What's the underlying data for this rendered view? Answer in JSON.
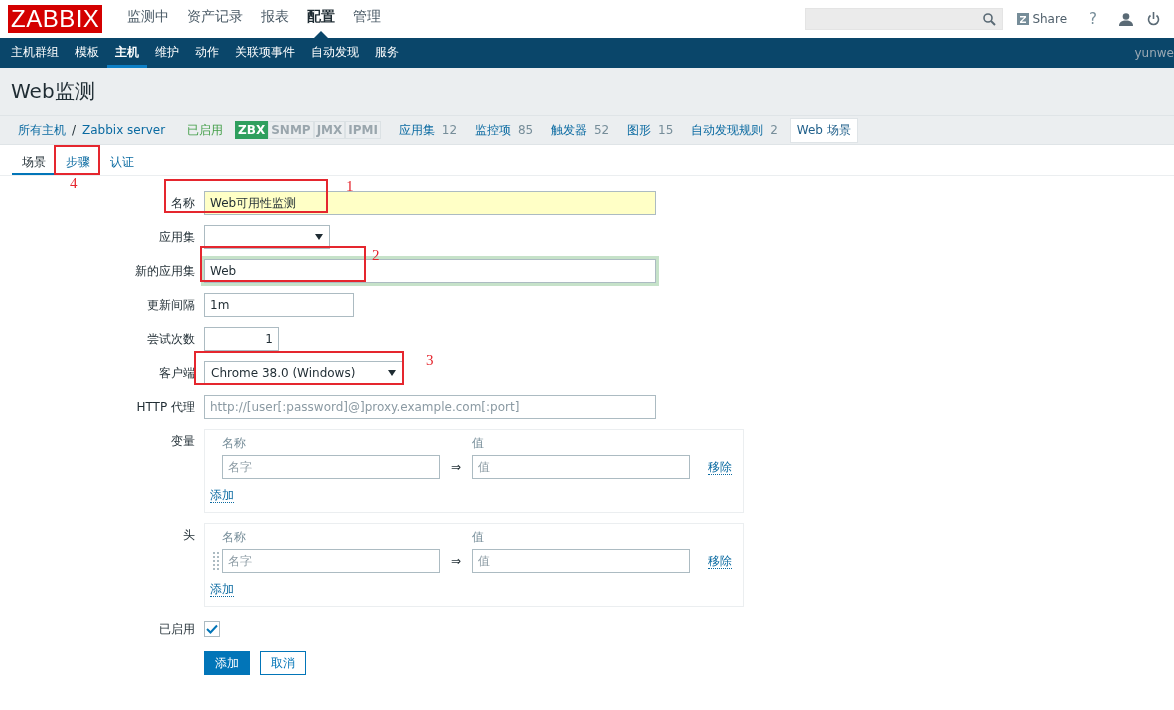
{
  "top_nav": {
    "logo": "ZABBIX",
    "menu": [
      {
        "label": "监测中",
        "selected": false
      },
      {
        "label": "资产记录",
        "selected": false
      },
      {
        "label": "报表",
        "selected": false
      },
      {
        "label": "配置",
        "selected": true
      },
      {
        "label": "管理",
        "selected": false
      }
    ],
    "share": "Share",
    "help": "?"
  },
  "sub_nav": {
    "items": [
      {
        "label": "主机群组",
        "selected": false
      },
      {
        "label": "模板",
        "selected": false
      },
      {
        "label": "主机",
        "selected": true
      },
      {
        "label": "维护",
        "selected": false
      },
      {
        "label": "动作",
        "selected": false
      },
      {
        "label": "关联项事件",
        "selected": false
      },
      {
        "label": "自动发现",
        "selected": false
      },
      {
        "label": "服务",
        "selected": false
      }
    ],
    "user": "yunwe"
  },
  "page_title": "Web监测",
  "breadcrumb": {
    "root": "所有主机",
    "separator": "/",
    "host": "Zabbix server",
    "status": "已启用",
    "availability": [
      {
        "label": "ZBX",
        "on": true
      },
      {
        "label": "SNMP",
        "on": false
      },
      {
        "label": "JMX",
        "on": false
      },
      {
        "label": "IPMI",
        "on": false
      }
    ],
    "links": [
      {
        "label": "应用集",
        "count": "12",
        "selected": false
      },
      {
        "label": "监控项",
        "count": "85",
        "selected": false
      },
      {
        "label": "触发器",
        "count": "52",
        "selected": false
      },
      {
        "label": "图形",
        "count": "15",
        "selected": false
      },
      {
        "label": "自动发现规则",
        "count": "2",
        "selected": false
      },
      {
        "label": "Web 场景",
        "selected": true
      }
    ]
  },
  "tabs": [
    {
      "label": "场景",
      "selected": true
    },
    {
      "label": "步骤",
      "selected": false,
      "annotation": "4"
    },
    {
      "label": "认证",
      "selected": false
    }
  ],
  "form": {
    "rows": [
      {
        "kind": "text",
        "label": "名称",
        "value": "Web可用性监测",
        "autofilled": true,
        "focused": false,
        "annotation": "1"
      },
      {
        "kind": "select",
        "label": "应用集"
      },
      {
        "kind": "text",
        "label": "新的应用集",
        "value": "Web",
        "autofilled": false,
        "focused": true,
        "annotation": "2"
      },
      {
        "kind": "text",
        "label": "更新间隔",
        "value": "1m",
        "autofilled": false,
        "focused": false
      },
      {
        "kind": "number",
        "label": "尝试次数",
        "value": "1"
      },
      {
        "kind": "select",
        "label": "客户端",
        "value": "Chrome 38.0 (Windows)",
        "annotation": "3"
      },
      {
        "kind": "text",
        "label": "HTTP 代理",
        "placeholder": "http://[user[:password]@]proxy.example.com[:port]",
        "autofilled": false,
        "focused": false
      },
      {
        "kind": "pairs",
        "label": "变量",
        "name_header": "名称",
        "value_header": "值",
        "draggable": false,
        "pairs": [
          {
            "name_placeholder": "名字",
            "arrow": "⇒",
            "value_placeholder": "值",
            "remove": "移除"
          }
        ],
        "add": "添加"
      },
      {
        "kind": "pairs",
        "label": "头",
        "name_header": "名称",
        "value_header": "值",
        "draggable": true,
        "pairs": [
          {
            "name_placeholder": "名字",
            "arrow": "⇒",
            "value_placeholder": "值",
            "remove": "移除"
          }
        ],
        "add": "添加"
      },
      {
        "kind": "checkbox",
        "label": "已启用",
        "checked": true
      }
    ],
    "buttons": [
      {
        "label": "添加",
        "primary": true
      },
      {
        "label": "取消",
        "primary": false
      }
    ]
  }
}
